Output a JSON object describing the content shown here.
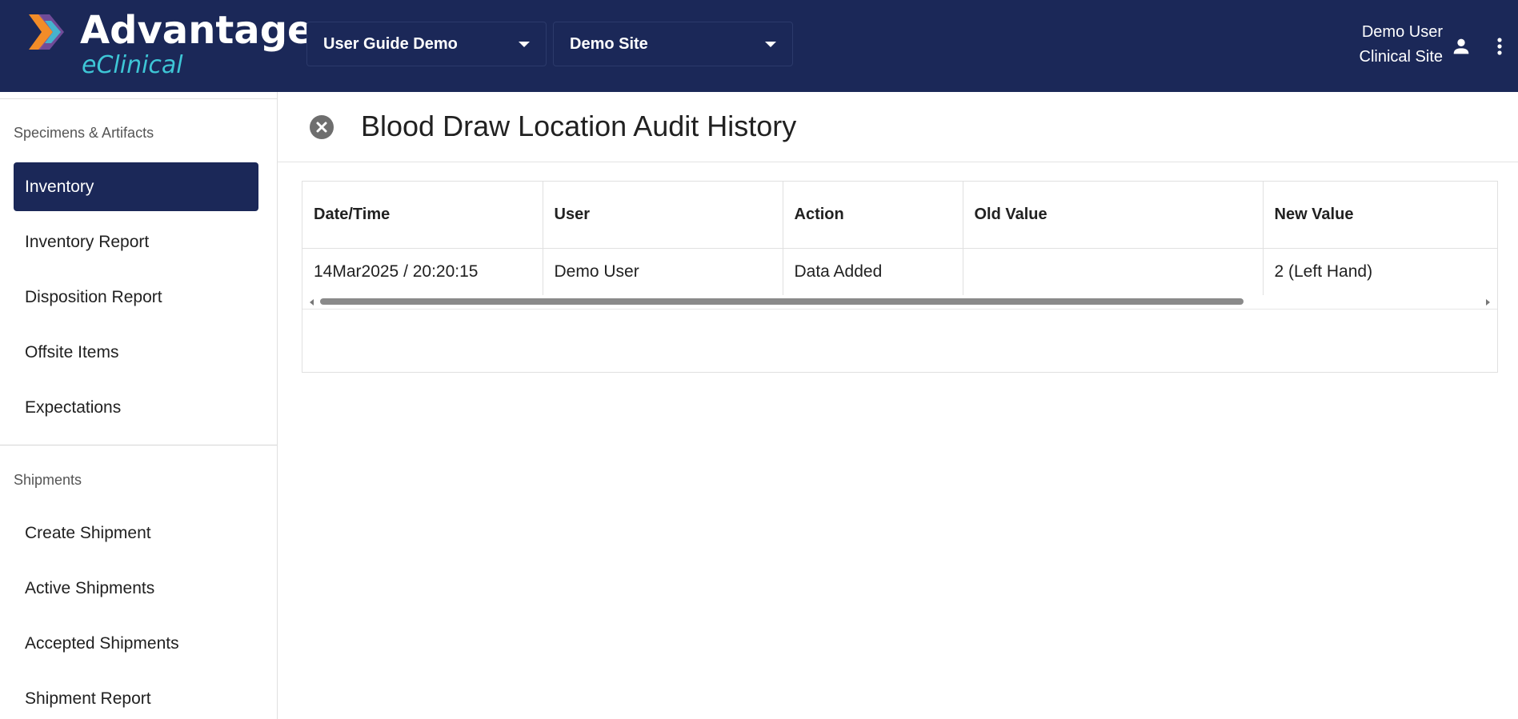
{
  "app": {
    "logo_title": "Advantage",
    "logo_subtitle": "eClinical",
    "accent_color": "#3ec6d6",
    "header_color": "#1b2858"
  },
  "header": {
    "study_selector": {
      "value": "User Guide Demo"
    },
    "site_selector": {
      "value": "Demo Site"
    },
    "user_name": "Demo User",
    "user_role": "Clinical Site",
    "icons": [
      "person-icon",
      "more-vert-icon"
    ]
  },
  "sidebar": {
    "sections": [
      {
        "label": "Specimens & Artifacts",
        "items": [
          {
            "label": "Inventory",
            "active": true
          },
          {
            "label": "Inventory Report"
          },
          {
            "label": "Disposition Report"
          },
          {
            "label": "Offsite Items"
          },
          {
            "label": "Expectations"
          }
        ]
      },
      {
        "label": "Shipments",
        "items": [
          {
            "label": "Create Shipment"
          },
          {
            "label": "Active Shipments"
          },
          {
            "label": "Accepted Shipments"
          },
          {
            "label": "Shipment Report"
          }
        ]
      }
    ]
  },
  "main": {
    "title": "Blood Draw Location Audit History",
    "close_icon": "close-circle-icon",
    "table": {
      "columns": [
        "Date/Time",
        "User",
        "Action",
        "Old Value",
        "New Value"
      ],
      "rows": [
        [
          "14Mar2025 / 20:20:15",
          "Demo User",
          "Data Added",
          "",
          "2 (Left Hand)"
        ]
      ]
    }
  }
}
